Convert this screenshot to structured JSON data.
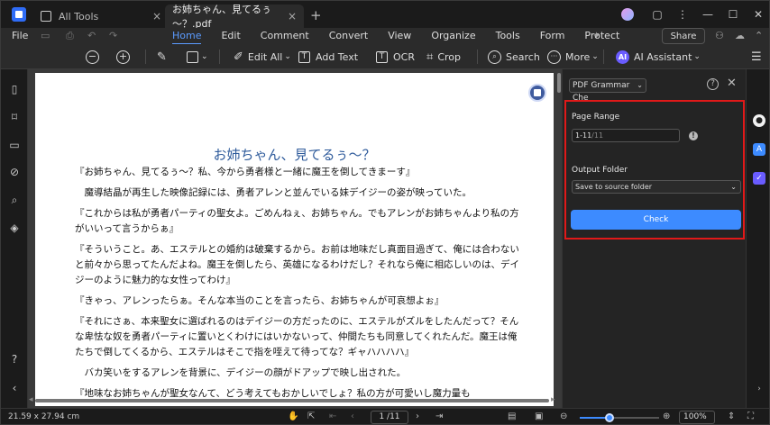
{
  "titlebar": {
    "tabs": [
      {
        "label": "All Tools"
      },
      {
        "label": "お姉ちゃん、見てるぅ～？.pdf"
      }
    ],
    "add_tab": "+",
    "close_glyph": "×",
    "controls": {
      "minimize": "—",
      "restore": "☐",
      "close": "✕"
    }
  },
  "menubar": {
    "file": "File",
    "items": [
      "Home",
      "Edit",
      "Comment",
      "Convert",
      "View",
      "Organize",
      "Tools",
      "Form",
      "Protect"
    ],
    "active": "Home",
    "share": "Share"
  },
  "toolbar": {
    "edit_all": "Edit All",
    "add_text": "Add Text",
    "ocr": "OCR",
    "crop": "Crop",
    "search": "Search",
    "more": "More",
    "ai_assistant": "AI Assistant",
    "ai_badge": "AI"
  },
  "document": {
    "title": "お姉ちゃん、見てるぅ～？",
    "paragraphs": [
      "『お姉ちゃん、見てるぅ～？私、今から勇者様と一緒に魔王を倒してきまーす』",
      "　魔導結晶が再生した映像記録には、勇者アレンと並んでいる妹デイジーの姿が映っていた。",
      "『これからは私が勇者パーティの聖女よ。ごめんねぇ、お姉ちゃん。でもアレンがお姉ちゃんより私の方がいいって言うからぁ』",
      "『そういうこと。あ、エステルとの婚約は破棄するから。お前は地味だし真面目過ぎて、俺には合わないと前々から思ってたんだよね。魔王を倒したら、英雄になるわけだし？それなら俺に相応しいのは、デイジーのように魅力的な女性ってわけ』",
      "『きゃっ、アレンったらぁ。そんな本当のことを言ったら、お姉ちゃんが可哀想よぉ』",
      "『それにさぁ、本来聖女に選ばれるのはデイジーの方だったのに、エステルがズルをしたんだって？そんな卑怯な奴を勇者パーティに置いとくわけにはいかないって、仲間たちも同意してくれたんだ。魔王は俺たちで倒してくるから、エステルはそこで指を咥えて待ってな？ギャハハハハ』",
      "　バカ笑いをするアレンを背景に、デイジーの顔がドアップで映し出された。",
      "『地味なお姉ちゃんが聖女なんて、どう考えてもおかしいでしょ？私の方が可愛いし魔力量も"
    ]
  },
  "panel": {
    "mode": "PDF Grammar Che",
    "help": "?",
    "close": "✕",
    "page_range_label": "Page Range",
    "page_range_value": "1-11",
    "page_range_total": "/11",
    "info": "!",
    "output_folder_label": "Output Folder",
    "output_folder_value": "Save to source folder",
    "check_button": "Check"
  },
  "statusbar": {
    "dimensions": "21.59 x 27.94 cm",
    "page": "1 /11",
    "zoom": "100%",
    "zoom_fraction": 0.38
  }
}
